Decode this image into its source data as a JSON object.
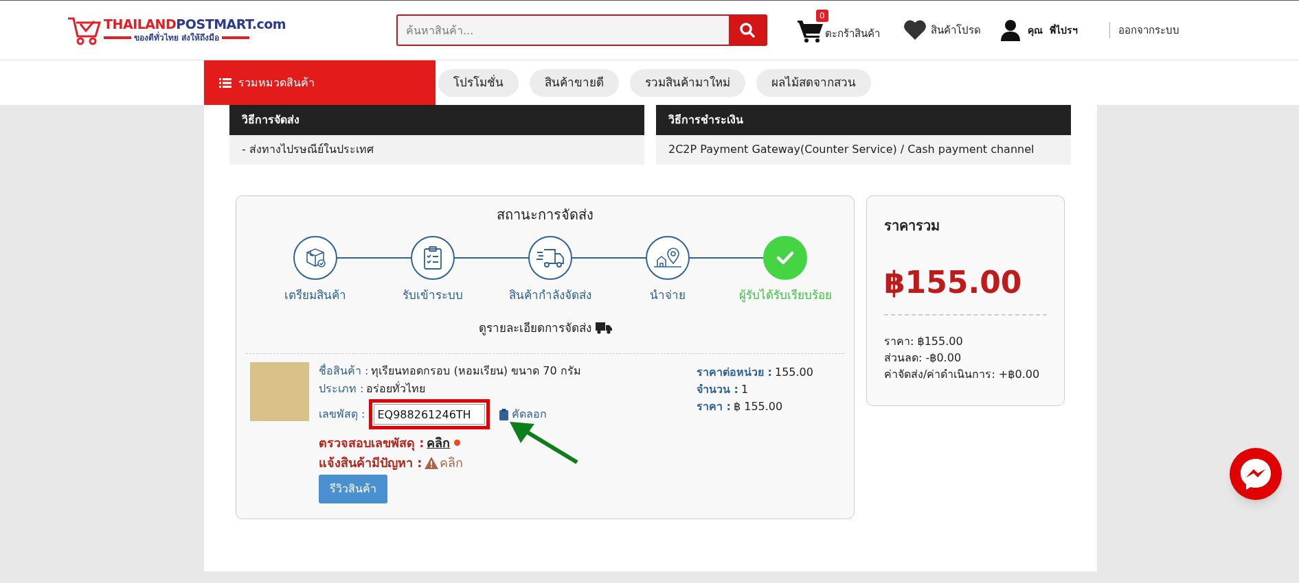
{
  "header": {
    "logo": {
      "name_parts": [
        "THAILAND",
        "POSTMART.com"
      ],
      "tagline": "ของดีทั่วไทย ส่งให้ถึงมือ"
    },
    "search": {
      "placeholder": "ค้นหาสินค้า..."
    },
    "cart": {
      "label": "ตะกร้าสินค้า",
      "count": "0"
    },
    "favorites": {
      "label": "สินค้าโปรด"
    },
    "user": {
      "greeting": "คุณ",
      "name": "พี่ไปรฯ"
    },
    "logout": "ออกจากระบบ"
  },
  "nav": {
    "category_button": "รวมหมวดสินค้า",
    "items": [
      "โปรโมชั่น",
      "สินค้าขายดี",
      "รวมสินค้ามาใหม่",
      "ผลไม้สดจากสวน"
    ]
  },
  "info_boxes": [
    {
      "title": "วิธีการจัดส่ง",
      "text": "- ส่งทางไปรษณีย์ในประเทศ"
    },
    {
      "title": "วิธีการชำระเงิน",
      "text": "2C2P Payment Gateway(Counter Service) / Cash payment channel"
    }
  ],
  "status": {
    "title": "สถานะการจัดส่ง",
    "steps": [
      {
        "kind": "box",
        "label": "เตรียมสินค้า",
        "selected": false
      },
      {
        "kind": "clipboard",
        "label": "รับเข้าระบบ",
        "selected": false
      },
      {
        "kind": "truck",
        "label": "สินค้ากำลังจัดส่ง",
        "selected": false
      },
      {
        "kind": "map",
        "label": "นำจ่าย",
        "selected": false
      },
      {
        "kind": "done",
        "label": "ผู้รับได้รับเรียบร้อย",
        "selected": true
      }
    ],
    "details_link": "ดูรายละเอียดการจัดส่ง"
  },
  "product": {
    "name_label": "ชื่อสินค้า :",
    "name": "ทุเรียนทอดกรอบ (หอมเรียน) ขนาด 70 กรัม",
    "type_label": "ประเภท :",
    "type": "อร่อยทั่วไทย",
    "tracking_label": "เลขพัสดุ :",
    "tracking_number": "EQ988261246TH",
    "tracking_highlighted": true,
    "annotation_arrow": true,
    "copy_link": "คัดลอก",
    "check_label": "ตรวจสอบเลขพัสดุ :",
    "check_link": "คลิก",
    "report_label": "แจ้งสินค้ามีปัญหา :",
    "report_link": "คลิก",
    "review_button": "รีวิวสินค้า",
    "unit_price_label": "ราคาต่อหน่วย :",
    "unit_price": "155.00",
    "quantity_label": "จำนวน :",
    "quantity": "1",
    "price_label": "ราคา :",
    "price": "฿ 155.00"
  },
  "summary": {
    "title": "ราคารวม",
    "total": "฿155.00",
    "lines": [
      "ราคา: ฿155.00",
      "ส่วนลด: -฿0.00",
      "ค่าจัดส่ง/ค่าดำเนินการ: +฿0.00"
    ]
  }
}
